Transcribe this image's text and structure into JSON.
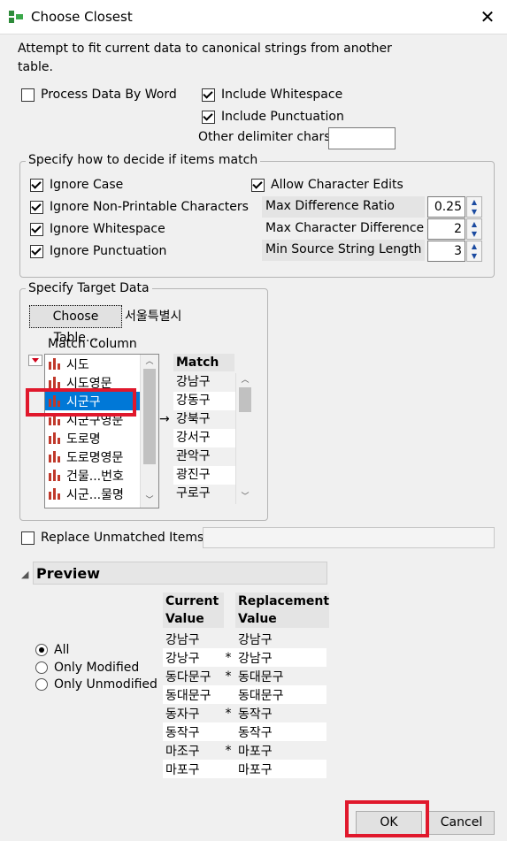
{
  "window": {
    "title": "Choose Closest",
    "close_glyph": "✕",
    "icon": "jmp-app-icon"
  },
  "description": "Attempt to fit current data to canonical strings from another table.",
  "options": {
    "process_by_word": {
      "label": "Process Data By Word",
      "checked": false
    },
    "include_whitespace": {
      "label": "Include Whitespace",
      "checked": true
    },
    "include_punctuation": {
      "label": "Include Punctuation",
      "checked": true
    },
    "other_delimiter": {
      "label": "Other delimiter chars",
      "value": ""
    }
  },
  "match_group": {
    "title": "Specify how to decide if items match",
    "ignore_case": {
      "label": "Ignore Case",
      "checked": true
    },
    "ignore_nonprintable": {
      "label": "Ignore Non-Printable Characters",
      "checked": true
    },
    "ignore_whitespace": {
      "label": "Ignore Whitespace",
      "checked": true
    },
    "ignore_punctuation": {
      "label": "Ignore Punctuation",
      "checked": true
    },
    "allow_edits": {
      "label": "Allow Character Edits",
      "checked": true
    },
    "max_diff_ratio": {
      "label": "Max Difference Ratio",
      "value": "0.25"
    },
    "max_char_diff": {
      "label": "Max Character Difference",
      "value": "2"
    },
    "min_source_len": {
      "label": "Min Source String Length",
      "value": "3"
    },
    "spin_up": "▲",
    "spin_down": "▼"
  },
  "target_group": {
    "title": "Specify Target Data",
    "choose_table_label": "Choose Table...",
    "table_name": "서울특별시",
    "match_column_label": "Match Column",
    "columns": [
      "시도",
      "시도영문",
      "시군구",
      "시군구영문",
      "도로명",
      "도로명영문",
      "건물...번호",
      "시군...물명"
    ],
    "selected_column": "시군구",
    "arrow": "→",
    "match_header": "Match",
    "match_values": [
      "강남구",
      "강동구",
      "강북구",
      "강서구",
      "관악구",
      "광진구",
      "구로구"
    ]
  },
  "replace_unmatched": {
    "label": "Replace Unmatched Items",
    "checked": false,
    "value": ""
  },
  "preview": {
    "title": "Preview",
    "disclosure": "◢",
    "radio_all": "All",
    "radio_modified": "Only Modified",
    "radio_unmodified": "Only Unmodified",
    "header_current": "Current Value",
    "header_replacement": "Replacement Value",
    "rows": [
      {
        "current": "강남구",
        "mark": "",
        "replacement": "강남구"
      },
      {
        "current": "강낭구",
        "mark": "*",
        "replacement": "강남구"
      },
      {
        "current": "동다문구",
        "mark": "*",
        "replacement": "동대문구"
      },
      {
        "current": "동대문구",
        "mark": "",
        "replacement": "동대문구"
      },
      {
        "current": "동자구",
        "mark": "*",
        "replacement": "동작구"
      },
      {
        "current": "동작구",
        "mark": "",
        "replacement": "동작구"
      },
      {
        "current": "마조구",
        "mark": "*",
        "replacement": "마포구"
      },
      {
        "current": "마포구",
        "mark": "",
        "replacement": "마포구"
      }
    ]
  },
  "buttons": {
    "ok": "OK",
    "cancel": "Cancel"
  },
  "colors": {
    "highlight": "#e0182c",
    "selection": "#0078d7",
    "bar_icon": "#c0392b"
  }
}
